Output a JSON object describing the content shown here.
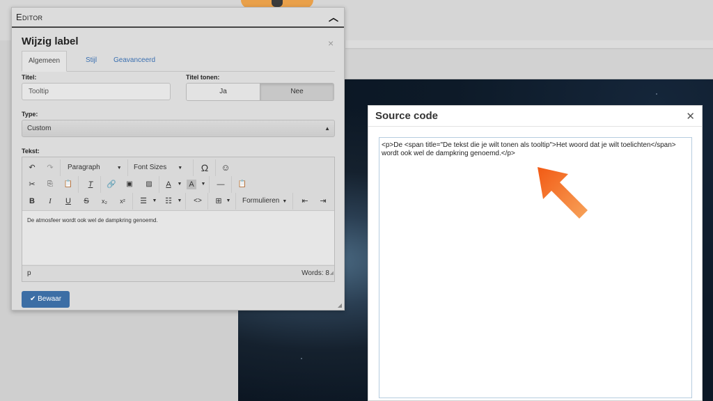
{
  "editor": {
    "window_title": "Editor",
    "panel_title": "Wijzig label",
    "tabs": [
      "Algemeen",
      "Stijl",
      "Geavanceerd"
    ],
    "title_label": "Titel:",
    "title_value": "Tooltip",
    "show_title_label": "Titel tonen:",
    "show_title_options": [
      "Ja",
      "Nee"
    ],
    "show_title_selected": "Nee",
    "type_label": "Type:",
    "type_value": "Custom",
    "text_label": "Tekst:",
    "toolbar": {
      "block_format": "Paragraph",
      "font_sizes": "Font Sizes",
      "forms": "Formulieren"
    },
    "content": "De atmosfeer wordt ook wel de dampkring genoemd.",
    "status_path": "p",
    "word_count": "Words: 8",
    "save_label": "Bewaar"
  },
  "source_dialog": {
    "title": "Source code",
    "code": "<p>De <span title=\"De tekst die je wilt tonen als tooltip\">Het woord dat je wilt toelichten</span> wordt ook wel de dampkring genoemd.</p>"
  },
  "colors": {
    "accent": "#3c6ea5",
    "arrow": "#f26b1d",
    "link": "#3a6fb0"
  },
  "icons": [
    "undo-icon",
    "redo-icon",
    "omega-icon",
    "emoji-icon",
    "cut-icon",
    "copy-icon",
    "paste-icon",
    "clear-format-icon",
    "link-icon",
    "media-icon",
    "image-icon",
    "text-color-icon",
    "bg-color-icon",
    "hr-icon",
    "paste-text-icon",
    "bold-icon",
    "italic-icon",
    "underline-icon",
    "strikethrough-icon",
    "subscript-icon",
    "superscript-icon",
    "bullet-list-icon",
    "numbered-list-icon",
    "code-icon",
    "table-icon",
    "outdent-icon",
    "indent-icon"
  ]
}
